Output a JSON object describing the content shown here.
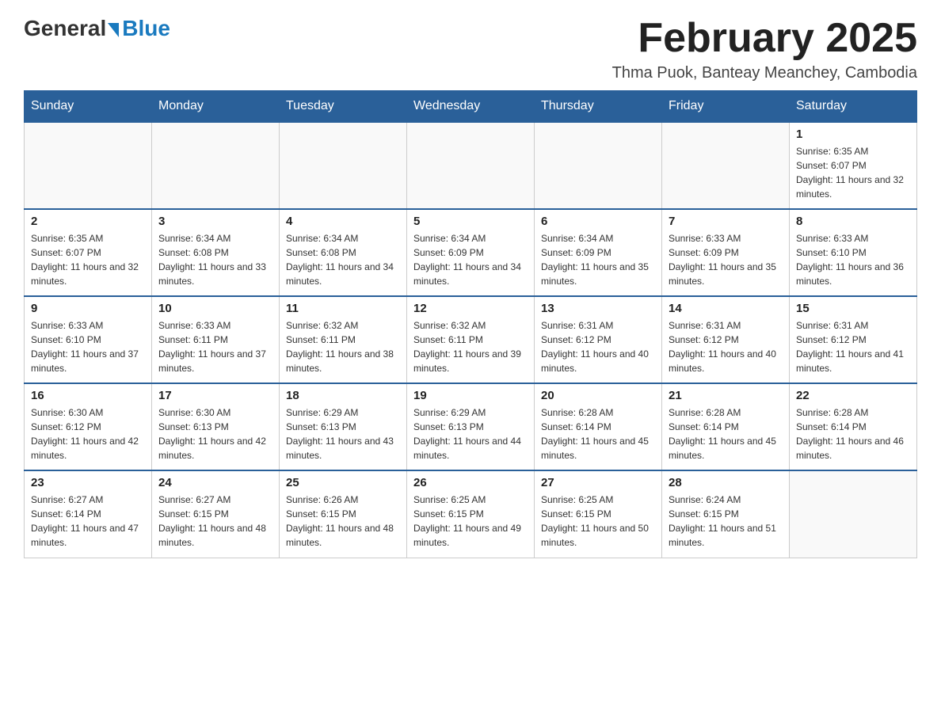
{
  "logo": {
    "general": "General",
    "blue": "Blue"
  },
  "header": {
    "title": "February 2025",
    "subtitle": "Thma Puok, Banteay Meanchey, Cambodia"
  },
  "weekdays": [
    "Sunday",
    "Monday",
    "Tuesday",
    "Wednesday",
    "Thursday",
    "Friday",
    "Saturday"
  ],
  "weeks": [
    [
      {
        "day": "",
        "sunrise": "",
        "sunset": "",
        "daylight": ""
      },
      {
        "day": "",
        "sunrise": "",
        "sunset": "",
        "daylight": ""
      },
      {
        "day": "",
        "sunrise": "",
        "sunset": "",
        "daylight": ""
      },
      {
        "day": "",
        "sunrise": "",
        "sunset": "",
        "daylight": ""
      },
      {
        "day": "",
        "sunrise": "",
        "sunset": "",
        "daylight": ""
      },
      {
        "day": "",
        "sunrise": "",
        "sunset": "",
        "daylight": ""
      },
      {
        "day": "1",
        "sunrise": "Sunrise: 6:35 AM",
        "sunset": "Sunset: 6:07 PM",
        "daylight": "Daylight: 11 hours and 32 minutes."
      }
    ],
    [
      {
        "day": "2",
        "sunrise": "Sunrise: 6:35 AM",
        "sunset": "Sunset: 6:07 PM",
        "daylight": "Daylight: 11 hours and 32 minutes."
      },
      {
        "day": "3",
        "sunrise": "Sunrise: 6:34 AM",
        "sunset": "Sunset: 6:08 PM",
        "daylight": "Daylight: 11 hours and 33 minutes."
      },
      {
        "day": "4",
        "sunrise": "Sunrise: 6:34 AM",
        "sunset": "Sunset: 6:08 PM",
        "daylight": "Daylight: 11 hours and 34 minutes."
      },
      {
        "day": "5",
        "sunrise": "Sunrise: 6:34 AM",
        "sunset": "Sunset: 6:09 PM",
        "daylight": "Daylight: 11 hours and 34 minutes."
      },
      {
        "day": "6",
        "sunrise": "Sunrise: 6:34 AM",
        "sunset": "Sunset: 6:09 PM",
        "daylight": "Daylight: 11 hours and 35 minutes."
      },
      {
        "day": "7",
        "sunrise": "Sunrise: 6:33 AM",
        "sunset": "Sunset: 6:09 PM",
        "daylight": "Daylight: 11 hours and 35 minutes."
      },
      {
        "day": "8",
        "sunrise": "Sunrise: 6:33 AM",
        "sunset": "Sunset: 6:10 PM",
        "daylight": "Daylight: 11 hours and 36 minutes."
      }
    ],
    [
      {
        "day": "9",
        "sunrise": "Sunrise: 6:33 AM",
        "sunset": "Sunset: 6:10 PM",
        "daylight": "Daylight: 11 hours and 37 minutes."
      },
      {
        "day": "10",
        "sunrise": "Sunrise: 6:33 AM",
        "sunset": "Sunset: 6:11 PM",
        "daylight": "Daylight: 11 hours and 37 minutes."
      },
      {
        "day": "11",
        "sunrise": "Sunrise: 6:32 AM",
        "sunset": "Sunset: 6:11 PM",
        "daylight": "Daylight: 11 hours and 38 minutes."
      },
      {
        "day": "12",
        "sunrise": "Sunrise: 6:32 AM",
        "sunset": "Sunset: 6:11 PM",
        "daylight": "Daylight: 11 hours and 39 minutes."
      },
      {
        "day": "13",
        "sunrise": "Sunrise: 6:31 AM",
        "sunset": "Sunset: 6:12 PM",
        "daylight": "Daylight: 11 hours and 40 minutes."
      },
      {
        "day": "14",
        "sunrise": "Sunrise: 6:31 AM",
        "sunset": "Sunset: 6:12 PM",
        "daylight": "Daylight: 11 hours and 40 minutes."
      },
      {
        "day": "15",
        "sunrise": "Sunrise: 6:31 AM",
        "sunset": "Sunset: 6:12 PM",
        "daylight": "Daylight: 11 hours and 41 minutes."
      }
    ],
    [
      {
        "day": "16",
        "sunrise": "Sunrise: 6:30 AM",
        "sunset": "Sunset: 6:12 PM",
        "daylight": "Daylight: 11 hours and 42 minutes."
      },
      {
        "day": "17",
        "sunrise": "Sunrise: 6:30 AM",
        "sunset": "Sunset: 6:13 PM",
        "daylight": "Daylight: 11 hours and 42 minutes."
      },
      {
        "day": "18",
        "sunrise": "Sunrise: 6:29 AM",
        "sunset": "Sunset: 6:13 PM",
        "daylight": "Daylight: 11 hours and 43 minutes."
      },
      {
        "day": "19",
        "sunrise": "Sunrise: 6:29 AM",
        "sunset": "Sunset: 6:13 PM",
        "daylight": "Daylight: 11 hours and 44 minutes."
      },
      {
        "day": "20",
        "sunrise": "Sunrise: 6:28 AM",
        "sunset": "Sunset: 6:14 PM",
        "daylight": "Daylight: 11 hours and 45 minutes."
      },
      {
        "day": "21",
        "sunrise": "Sunrise: 6:28 AM",
        "sunset": "Sunset: 6:14 PM",
        "daylight": "Daylight: 11 hours and 45 minutes."
      },
      {
        "day": "22",
        "sunrise": "Sunrise: 6:28 AM",
        "sunset": "Sunset: 6:14 PM",
        "daylight": "Daylight: 11 hours and 46 minutes."
      }
    ],
    [
      {
        "day": "23",
        "sunrise": "Sunrise: 6:27 AM",
        "sunset": "Sunset: 6:14 PM",
        "daylight": "Daylight: 11 hours and 47 minutes."
      },
      {
        "day": "24",
        "sunrise": "Sunrise: 6:27 AM",
        "sunset": "Sunset: 6:15 PM",
        "daylight": "Daylight: 11 hours and 48 minutes."
      },
      {
        "day": "25",
        "sunrise": "Sunrise: 6:26 AM",
        "sunset": "Sunset: 6:15 PM",
        "daylight": "Daylight: 11 hours and 48 minutes."
      },
      {
        "day": "26",
        "sunrise": "Sunrise: 6:25 AM",
        "sunset": "Sunset: 6:15 PM",
        "daylight": "Daylight: 11 hours and 49 minutes."
      },
      {
        "day": "27",
        "sunrise": "Sunrise: 6:25 AM",
        "sunset": "Sunset: 6:15 PM",
        "daylight": "Daylight: 11 hours and 50 minutes."
      },
      {
        "day": "28",
        "sunrise": "Sunrise: 6:24 AM",
        "sunset": "Sunset: 6:15 PM",
        "daylight": "Daylight: 11 hours and 51 minutes."
      },
      {
        "day": "",
        "sunrise": "",
        "sunset": "",
        "daylight": ""
      }
    ]
  ]
}
